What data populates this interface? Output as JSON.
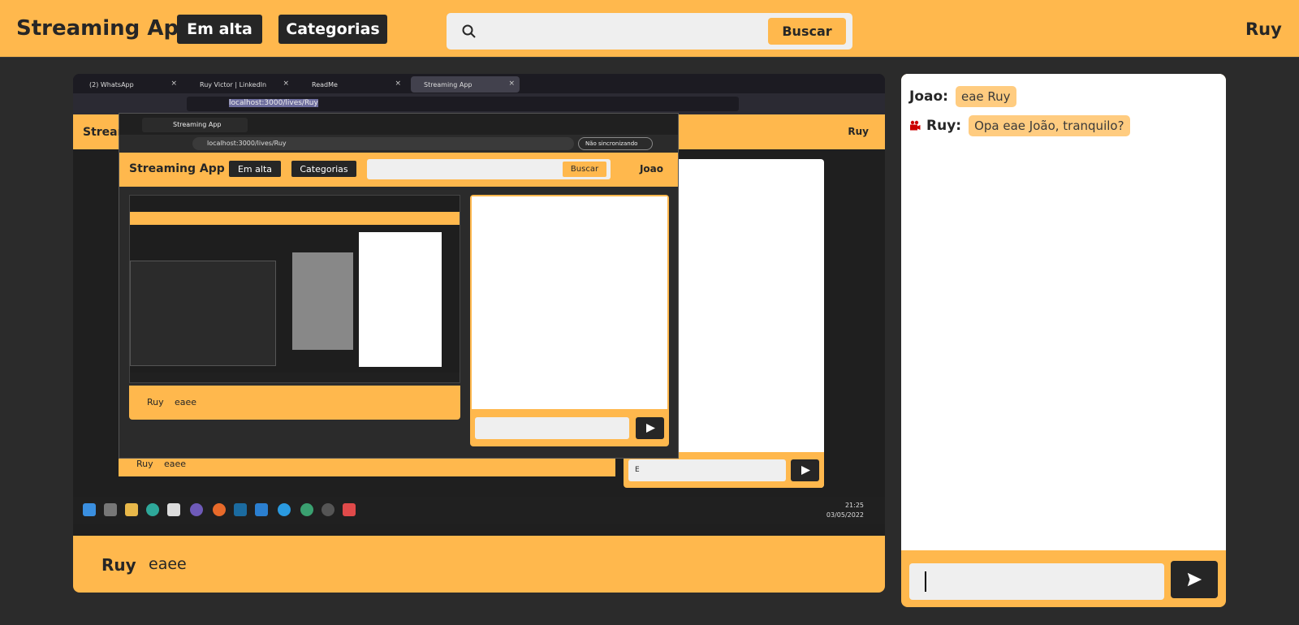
{
  "header": {
    "logo": "Streaming App",
    "nav": [
      {
        "label": "Em alta"
      },
      {
        "label": "Categorias"
      }
    ],
    "search": {
      "placeholder": "",
      "button_label": "Buscar"
    },
    "user": "Ruy"
  },
  "stream": {
    "streamer": "Ruy",
    "title": "eaee",
    "captured_screen": {
      "tabs": [
        "(2) WhatsApp",
        "Ruy Victor | LinkedIn",
        "ReadMe",
        "Streaming App"
      ],
      "url": "localhost:3000/lives/Ruy",
      "inner_app_title": "Stream",
      "inner_user": "Ruy",
      "window2": {
        "tab": "Streaming App",
        "url": "localhost:3000/lives/Ruy",
        "sync_label": "Não sincronizando",
        "logo": "Streaming App",
        "nav": [
          "Em alta",
          "Categorias"
        ],
        "search_button": "Buscar",
        "user": "Joao",
        "footer_user": "Ruy",
        "footer_title": "eaee"
      },
      "behind_footer_user": "Ruy",
      "behind_footer_title": "eaee",
      "chat_input_value": "E",
      "clock_time": "21:25",
      "clock_date": "03/05/2022"
    }
  },
  "chat": {
    "messages": [
      {
        "sender": "Joao:",
        "text": "eae Ruy",
        "icon": null
      },
      {
        "sender": "Ruy:",
        "text": "Opa eae João, tranquilo?",
        "icon": "video-camera-icon"
      }
    ],
    "input_value": "",
    "send_icon": "send-icon"
  },
  "colors": {
    "accent": "#ffb84d",
    "bubble": "#ffcc80",
    "dark": "#262626",
    "background": "#2b2b2b",
    "camera_icon": "#cc0000"
  }
}
